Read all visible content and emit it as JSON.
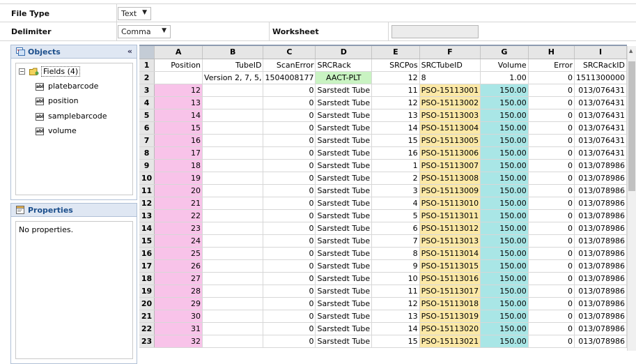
{
  "settings": {
    "file_type_label": "File Type",
    "file_type_value": "Text",
    "delimiter_label": "Delimiter",
    "delimiter_value": "Comma",
    "worksheet_label": "Worksheet",
    "worksheet_value": ""
  },
  "objects_panel": {
    "title": "Objects",
    "collapse_glyph": "«",
    "root_label": "Fields (4)",
    "fields": [
      "platebarcode",
      "position",
      "samplebarcode",
      "volume"
    ]
  },
  "properties_panel": {
    "title": "Properties",
    "empty_text": "No properties."
  },
  "grid": {
    "columns": [
      "A",
      "B",
      "C",
      "D",
      "E",
      "F",
      "G",
      "H",
      "I"
    ],
    "rows": [
      [
        "1",
        "Position",
        "TubeID",
        "ScanError",
        "SRCRack",
        "SRCPos",
        "SRCTubeID",
        "Volume",
        "Error",
        "SRCRackID"
      ],
      [
        "2",
        "",
        "Version 2, 7, 5,",
        "1504008177",
        "AACT-PLT",
        "12",
        "8",
        "1.00",
        "0",
        "1511300000"
      ],
      [
        "3",
        "12",
        "",
        "0",
        "Sarstedt Tube",
        "11",
        "PSO-15113001",
        "150.00",
        "0",
        "013/076431"
      ],
      [
        "4",
        "13",
        "",
        "0",
        "Sarstedt Tube",
        "12",
        "PSO-15113002",
        "150.00",
        "0",
        "013/076431"
      ],
      [
        "5",
        "14",
        "",
        "0",
        "Sarstedt Tube",
        "13",
        "PSO-15113003",
        "150.00",
        "0",
        "013/076431"
      ],
      [
        "6",
        "15",
        "",
        "0",
        "Sarstedt Tube",
        "14",
        "PSO-15113004",
        "150.00",
        "0",
        "013/076431"
      ],
      [
        "7",
        "16",
        "",
        "0",
        "Sarstedt Tube",
        "15",
        "PSO-15113005",
        "150.00",
        "0",
        "013/076431"
      ],
      [
        "8",
        "17",
        "",
        "0",
        "Sarstedt Tube",
        "16",
        "PSO-15113006",
        "150.00",
        "0",
        "013/076431"
      ],
      [
        "9",
        "18",
        "",
        "0",
        "Sarstedt Tube",
        "1",
        "PSO-15113007",
        "150.00",
        "0",
        "013/078986"
      ],
      [
        "10",
        "19",
        "",
        "0",
        "Sarstedt Tube",
        "2",
        "PSO-15113008",
        "150.00",
        "0",
        "013/078986"
      ],
      [
        "11",
        "20",
        "",
        "0",
        "Sarstedt Tube",
        "3",
        "PSO-15113009",
        "150.00",
        "0",
        "013/078986"
      ],
      [
        "12",
        "21",
        "",
        "0",
        "Sarstedt Tube",
        "4",
        "PSO-15113010",
        "150.00",
        "0",
        "013/078986"
      ],
      [
        "13",
        "22",
        "",
        "0",
        "Sarstedt Tube",
        "5",
        "PSO-15113011",
        "150.00",
        "0",
        "013/078986"
      ],
      [
        "14",
        "23",
        "",
        "0",
        "Sarstedt Tube",
        "6",
        "PSO-15113012",
        "150.00",
        "0",
        "013/078986"
      ],
      [
        "15",
        "24",
        "",
        "0",
        "Sarstedt Tube",
        "7",
        "PSO-15113013",
        "150.00",
        "0",
        "013/078986"
      ],
      [
        "16",
        "25",
        "",
        "0",
        "Sarstedt Tube",
        "8",
        "PSO-15113014",
        "150.00",
        "0",
        "013/078986"
      ],
      [
        "17",
        "26",
        "",
        "0",
        "Sarstedt Tube",
        "9",
        "PSO-15113015",
        "150.00",
        "0",
        "013/078986"
      ],
      [
        "18",
        "27",
        "",
        "0",
        "Sarstedt Tube",
        "10",
        "PSO-15113016",
        "150.00",
        "0",
        "013/078986"
      ],
      [
        "19",
        "28",
        "",
        "0",
        "Sarstedt Tube",
        "11",
        "PSO-15113017",
        "150.00",
        "0",
        "013/078986"
      ],
      [
        "20",
        "29",
        "",
        "0",
        "Sarstedt Tube",
        "12",
        "PSO-15113018",
        "150.00",
        "0",
        "013/078986"
      ],
      [
        "21",
        "30",
        "",
        "0",
        "Sarstedt Tube",
        "13",
        "PSO-15113019",
        "150.00",
        "0",
        "013/078986"
      ],
      [
        "22",
        "31",
        "",
        "0",
        "Sarstedt Tube",
        "14",
        "PSO-15113020",
        "150.00",
        "0",
        "013/078986"
      ],
      [
        "23",
        "32",
        "",
        "0",
        "Sarstedt Tube",
        "15",
        "PSO-15113021",
        "150.00",
        "0",
        "013/078986"
      ]
    ]
  },
  "colors": {
    "position_fill": "#f8c3e9",
    "tubeid_fill": "#fbe8a6",
    "volume_fill": "#a9e6e6",
    "rack_fill": "#c9f3c2",
    "panel_header": "#dfe7f3"
  }
}
